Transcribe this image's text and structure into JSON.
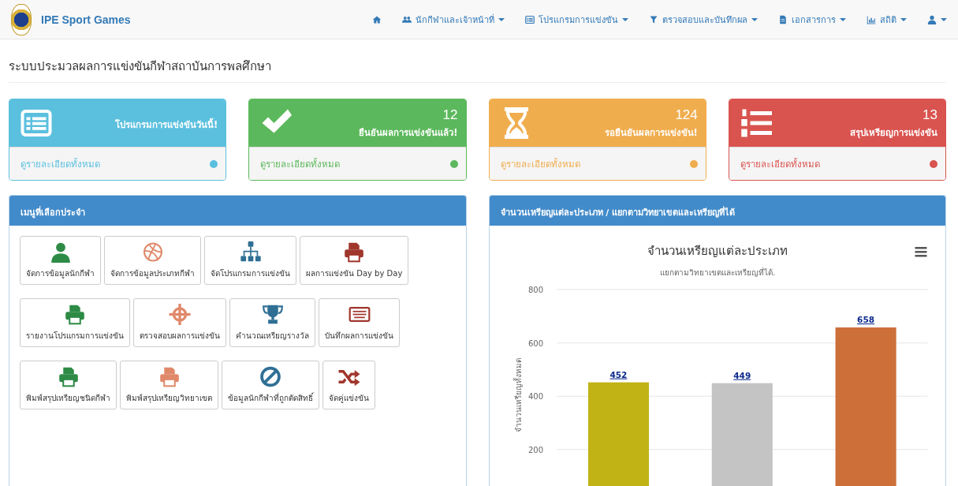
{
  "navbar": {
    "brand": "IPE Sport Games",
    "items": [
      {
        "kind": "home"
      },
      {
        "kind": "users",
        "label": "นักกีฬาและเจ้าหน้าที่"
      },
      {
        "kind": "list",
        "label": "โปรแกรมการแข่งขัน"
      },
      {
        "kind": "filter",
        "label": "ตรวจสอบและบันทึกผล"
      },
      {
        "kind": "file",
        "label": "เอกสารการ"
      },
      {
        "kind": "chart",
        "label": "สถิติ"
      },
      {
        "kind": "user"
      }
    ]
  },
  "page_title": "ระบบประมวลผลการแข่งขันกีฬาสถาบันการพลศึกษา",
  "cards": [
    {
      "kind": "list",
      "color": "#5bc0de",
      "label": "โปรแกรมการแข่งขันวันนี้!",
      "link": "ดูรายละเอียดทั้งหมด"
    },
    {
      "kind": "check",
      "color": "#5cb85c",
      "count": "12",
      "label": "ยืนยันผลการแข่งขันแล้ว!",
      "link": "ดูรายละเอียดทั้งหมด"
    },
    {
      "kind": "hourglass",
      "color": "#f0ad4e",
      "count": "124",
      "label": "รอยืนยันผลการแข่งขัน!",
      "link": "ดูรายละเอียดทั้งหมด"
    },
    {
      "kind": "ordered-list",
      "color": "#d9534f",
      "count": "13",
      "label": "สรุปเหรียญการแข่งขัน",
      "link": "ดูรายละเอียดทั้งหมด"
    }
  ],
  "menu_panel": {
    "title": "เมนูที่เลือกประจำ",
    "rows": [
      [
        {
          "kind": "user",
          "color": "#2e8b46",
          "label": "จัดการข้อมูลนักกีฬา"
        },
        {
          "kind": "ball",
          "color": "#e0896a",
          "label": "จัดการข้อมูลประเภทกีฬา"
        },
        {
          "kind": "sitemap",
          "color": "#2f6f95",
          "label": "จัดโปรแกรมการแข่งขัน"
        },
        {
          "kind": "print",
          "color": "#a0362c",
          "label": "ผลการแข่งขัน Day by Day"
        }
      ],
      [
        {
          "kind": "print",
          "color": "#2e8b46",
          "label": "รายงานโปรแกรมการแข่งขัน"
        },
        {
          "kind": "crosshair",
          "color": "#e0896a",
          "label": "ตรวจสอบผลการแข่งขัน"
        },
        {
          "kind": "trophy",
          "color": "#2f6f95",
          "label": "คำนวณเหรียญรางวัล"
        },
        {
          "kind": "keyboard",
          "color": "#a0362c",
          "label": "บันทึกผลการแข่งขัน"
        }
      ],
      [
        {
          "kind": "print",
          "color": "#2e8b46",
          "label": "พิมพ์สรุปเหรียญชนิดกีฬา"
        },
        {
          "kind": "print",
          "color": "#e0896a",
          "label": "พิมพ์สรุปเหรียญวิทยาเขต"
        },
        {
          "kind": "ban",
          "color": "#2f6f95",
          "label": "ข้อมูลนักกีฬาที่ถูกตัดสิทธิ์"
        },
        {
          "kind": "shuffle",
          "color": "#a0362c",
          "label": "จัดคู่แข่งขัน"
        }
      ]
    ]
  },
  "chart_panel": {
    "title": "จำนวนเหรียญแต่ละประเภท / แยกตามวิทยาเขตและเหรียญที่ได้",
    "chart_data": {
      "type": "bar",
      "title": "จำนวนเหรียญแต่ละประเภท",
      "subtitle": "แยกตามวิทยาเขตและเหรียญที่ได้.",
      "ylabel": "จำนวนเหรียญทั้งหมด",
      "ylim": [
        0,
        800
      ],
      "yticks": [
        200,
        400,
        600,
        800
      ],
      "grid": true,
      "data_labels": true,
      "series": [
        {
          "values": [
            452,
            449,
            658
          ],
          "colors": [
            "#c1b316",
            "#c4c4c4",
            "#cc6f39"
          ]
        }
      ]
    }
  }
}
